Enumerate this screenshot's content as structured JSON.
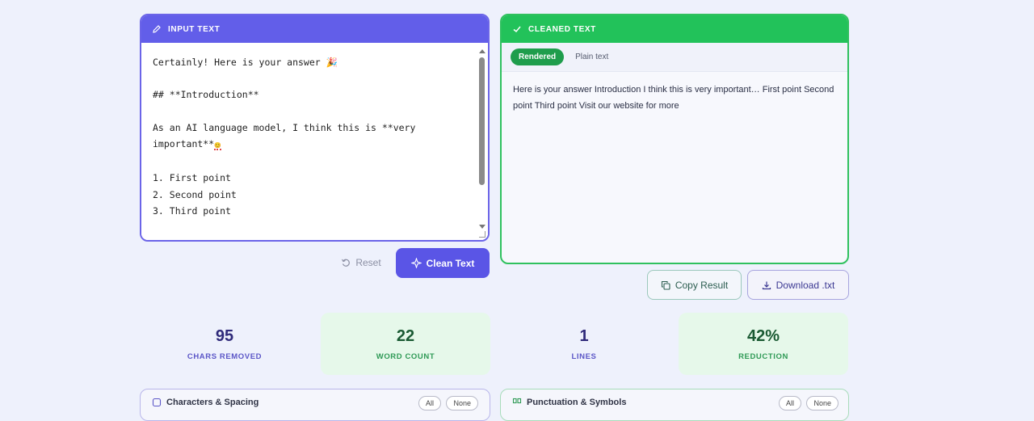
{
  "input_panel": {
    "header": "INPUT TEXT",
    "text": "Certainly! Here is your answer 🎉\n\n## **Introduction**\n\nAs an AI language model, I think this is **very\nimportant**",
    "text_tail": "\n\n1. First point\n2. Second point\n3. Third point",
    "emphasis_glyph": "😊"
  },
  "output_panel": {
    "header": "CLEANED TEXT",
    "tabs": [
      {
        "label": "Rendered",
        "active": true
      },
      {
        "label": "Plain text",
        "active": false
      }
    ],
    "text": "Here is your answer Introduction I think this is very important… First point Second point Third point Visit our website for more"
  },
  "actions": {
    "reset": "Reset",
    "clean": "Clean Text",
    "copy": "Copy Result",
    "download": "Download .txt"
  },
  "stats": [
    {
      "value": "95",
      "label": "CHARS REMOVED"
    },
    {
      "value": "22",
      "label": "WORD COUNT"
    },
    {
      "value": "1",
      "label": "LINES"
    },
    {
      "value": "42%",
      "label": "REDUCTION"
    }
  ],
  "sections": {
    "left": {
      "title": "Characters & Spacing",
      "all": "All",
      "none": "None"
    },
    "right": {
      "title": "Punctuation & Symbols",
      "all": "All",
      "none": "None"
    }
  },
  "colors": {
    "accent_purple": "#625ee9",
    "accent_green": "#22c25a",
    "background": "#eef1fc"
  },
  "icons": {
    "input_header": "pencil-icon",
    "output_header": "check-icon",
    "reset": "reset-icon",
    "clean": "sparkle-icon",
    "copy": "copy-icon",
    "download": "download-icon"
  }
}
